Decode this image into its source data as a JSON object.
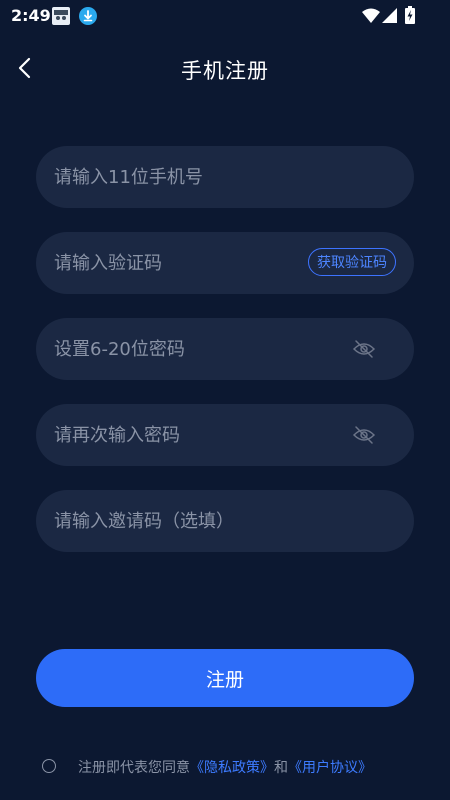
{
  "status_bar": {
    "time": "2:49",
    "icons": [
      "app-notification-icon",
      "download-icon",
      "wifi-icon",
      "signal-icon",
      "battery-charging-icon"
    ]
  },
  "header": {
    "title": "手机注册",
    "back_icon": "chevron-left-icon"
  },
  "form": {
    "phone_placeholder": "请输入11位手机号",
    "code_placeholder": "请输入验证码",
    "get_code_label": "获取验证码",
    "password_placeholder": "设置6-20位密码",
    "confirm_password_placeholder": "请再次输入密码",
    "invite_placeholder": "请输入邀请码（选填）",
    "submit_label": "注册"
  },
  "agreement": {
    "prefix": "注册即代表您同意",
    "privacy_link": "《隐私政策》",
    "conjunction": "和",
    "terms_link": "《用户协议》"
  },
  "colors": {
    "background": "#0c1831",
    "field_background": "#1b2843",
    "accent": "#2d6cf8",
    "link": "#3d7bff",
    "placeholder": "#8a93a6"
  }
}
